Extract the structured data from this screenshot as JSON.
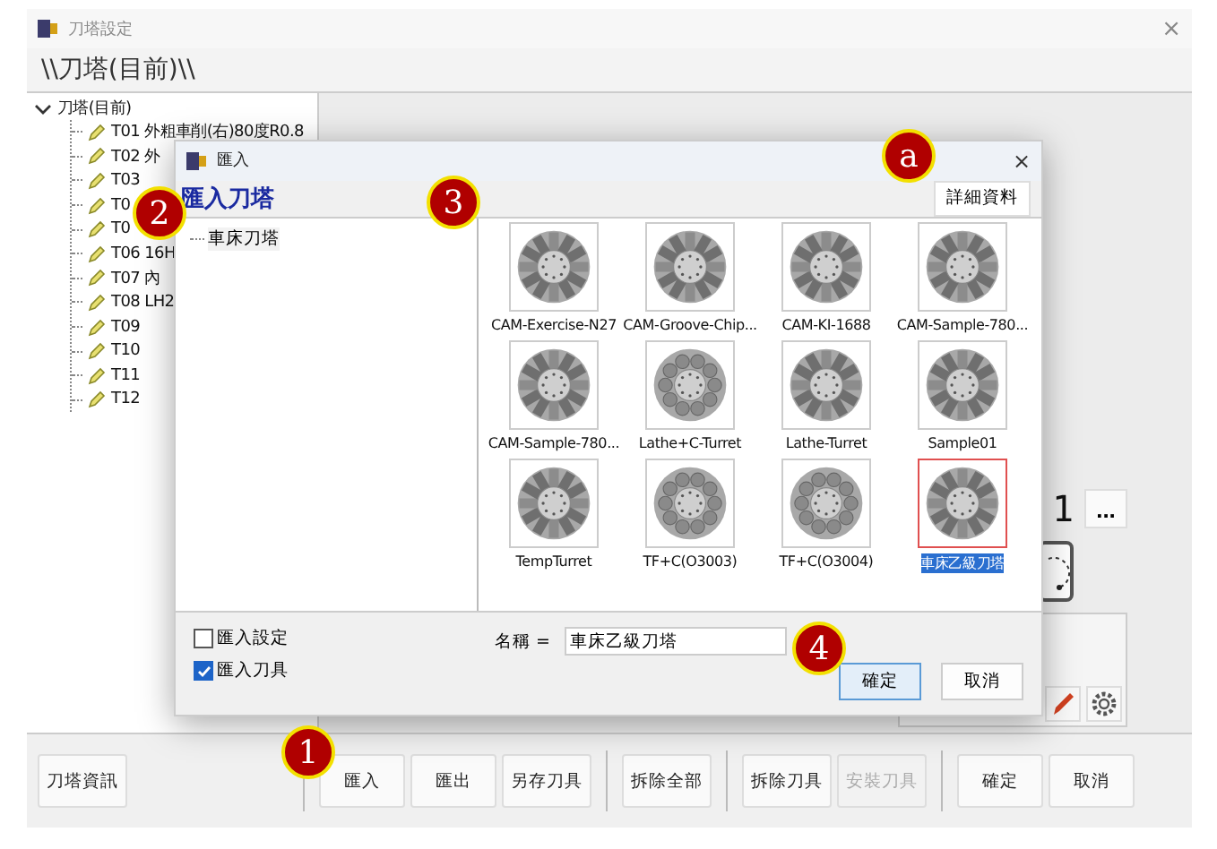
{
  "window": {
    "title": "刀塔設定",
    "close": "×"
  },
  "path": "\\\\刀塔(目前)\\\\",
  "tree": {
    "label": "刀塔(目前)",
    "expanded": true,
    "children": [
      {
        "label": "T01 外粗車削(右)80度R0.8"
      },
      {
        "label": "T02 外"
      },
      {
        "label": "T03"
      },
      {
        "label": "T0"
      },
      {
        "label": "T0"
      },
      {
        "label": "T06 16H"
      },
      {
        "label": "T07 內"
      },
      {
        "label": "T08 LH2"
      },
      {
        "label": "T09"
      },
      {
        "label": "T10"
      },
      {
        "label": "T11"
      },
      {
        "label": "T12"
      }
    ]
  },
  "side": {
    "value": "1",
    "more_button": "..."
  },
  "toolbar": [
    [
      {
        "label": "刀塔資訊",
        "disabled": false
      }
    ],
    [
      {
        "label": "匯入",
        "disabled": false
      },
      {
        "label": "匯出",
        "disabled": false
      },
      {
        "label": "另存刀具",
        "disabled": false
      }
    ],
    [
      {
        "label": "拆除全部",
        "disabled": false
      }
    ],
    [
      {
        "label": "拆除刀具",
        "disabled": false
      },
      {
        "label": "安裝刀具",
        "disabled": true
      }
    ],
    [
      {
        "label": "確定",
        "disabled": false
      },
      {
        "label": "取消",
        "disabled": false
      }
    ]
  ],
  "dialog": {
    "title": "匯入",
    "close": "×",
    "heading": "匯入刀塔",
    "details_button": "詳細資料",
    "tree": [
      {
        "label": "車床刀塔"
      }
    ],
    "turrets": [
      {
        "label": "CAM-Exercise-N27",
        "kind": "blade",
        "selected": false
      },
      {
        "label": "CAM-Groove-Chip...",
        "kind": "blade",
        "selected": false
      },
      {
        "label": "CAM-KI-1688",
        "kind": "blade",
        "selected": false
      },
      {
        "label": "CAM-Sample-780...",
        "kind": "blade",
        "selected": false
      },
      {
        "label": "CAM-Sample-780...",
        "kind": "blade",
        "selected": false
      },
      {
        "label": "Lathe+C-Turret",
        "kind": "round",
        "selected": false
      },
      {
        "label": "Lathe-Turret",
        "kind": "blade",
        "selected": false
      },
      {
        "label": "Sample01",
        "kind": "blade",
        "selected": false
      },
      {
        "label": "TempTurret",
        "kind": "blade",
        "selected": false
      },
      {
        "label": "TF+C(O3003)",
        "kind": "round",
        "selected": false
      },
      {
        "label": "TF+C(O3004)",
        "kind": "round",
        "selected": false
      },
      {
        "label": "車床乙級刀塔",
        "kind": "blade",
        "selected": true
      }
    ],
    "options": [
      {
        "label": "匯入設定",
        "checked": false
      },
      {
        "label": "匯入刀具",
        "checked": true
      }
    ],
    "name_label": "名稱 =",
    "name_value": "車床乙級刀塔",
    "ok_button": "確定",
    "cancel_button": "取消"
  },
  "callouts": [
    {
      "label": "1"
    },
    {
      "label": "2"
    },
    {
      "label": "3"
    },
    {
      "label": "4"
    },
    {
      "label": "a"
    }
  ]
}
